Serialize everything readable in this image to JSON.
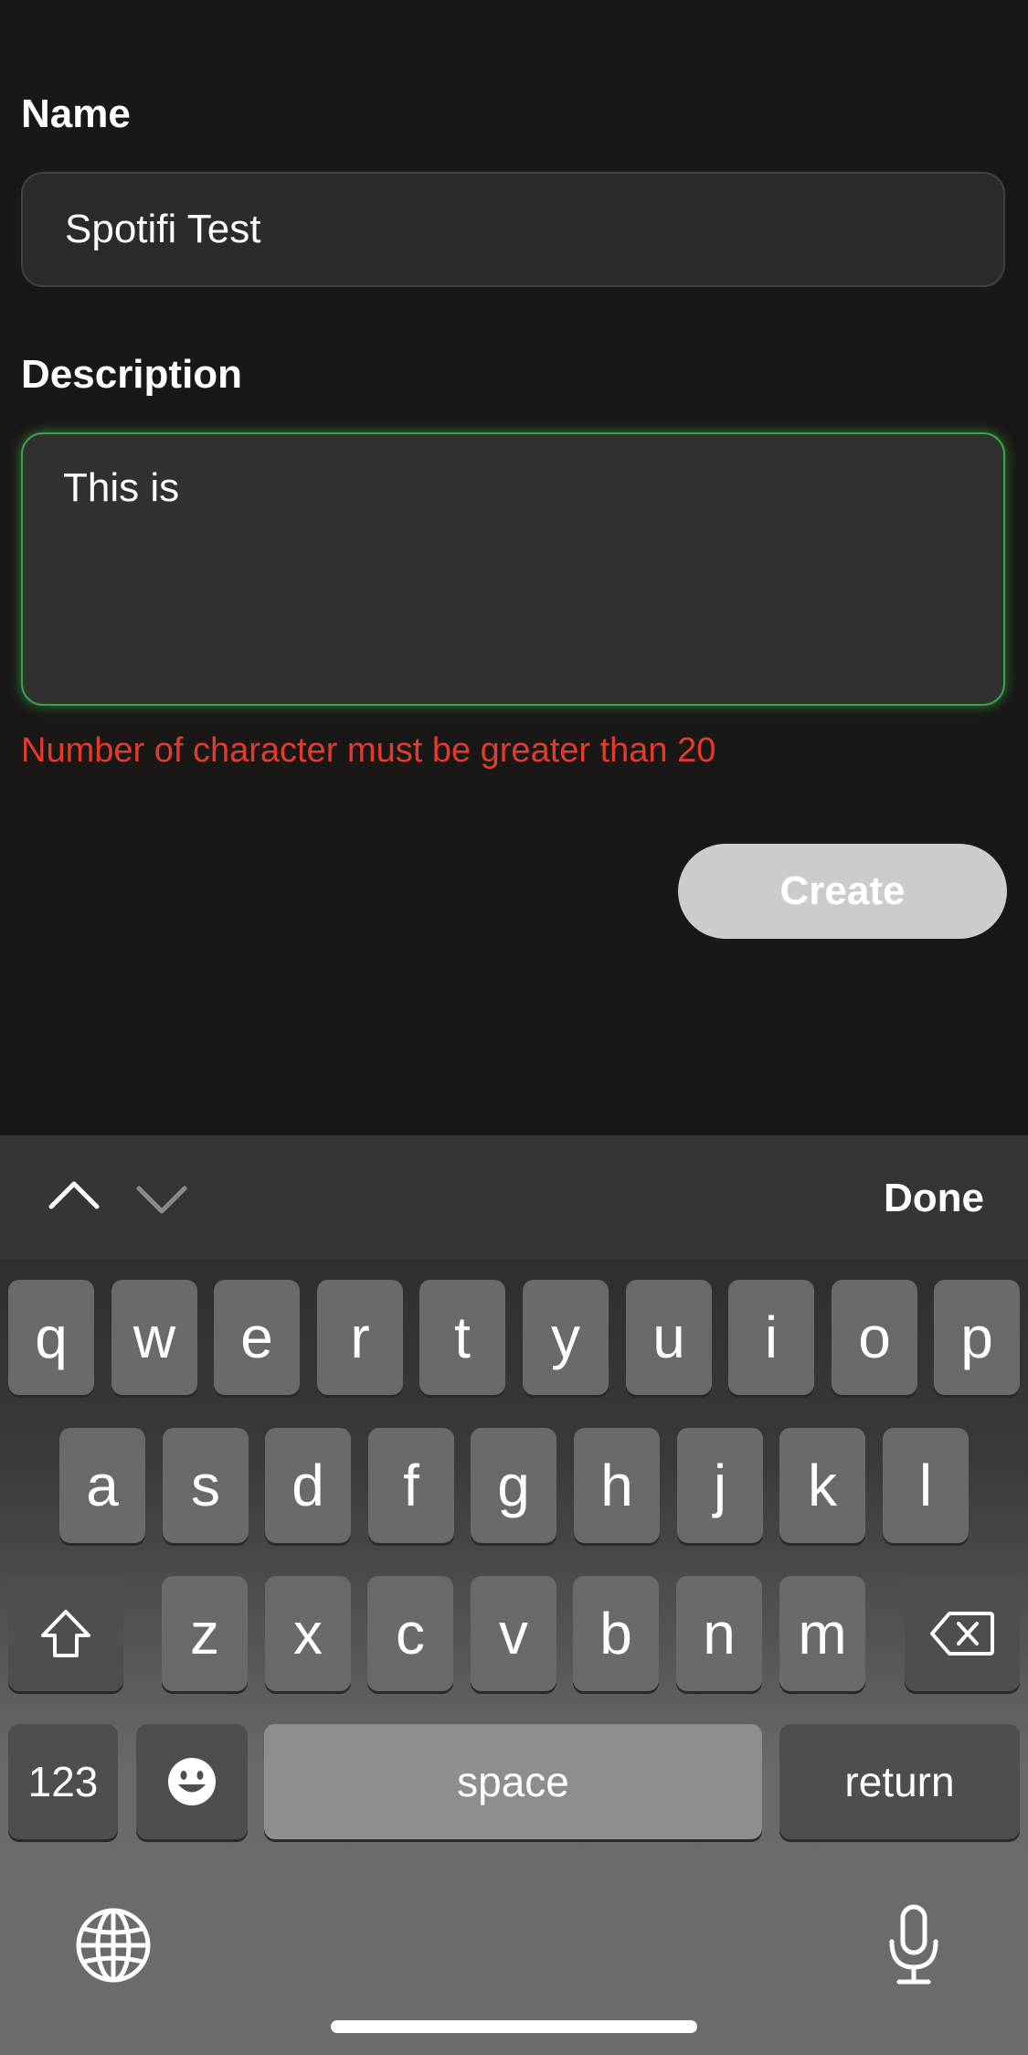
{
  "form": {
    "name_label": "Name",
    "name_value": "Spotifi Test",
    "description_label": "Description",
    "description_value": "This is",
    "error_message": "Number of character must be greater than 20",
    "create_label": "Create"
  },
  "keyboard": {
    "toolbar": {
      "prev_icon": "chevron-up-icon",
      "next_icon": "chevron-down-icon",
      "done_label": "Done"
    },
    "rows": [
      [
        "q",
        "w",
        "e",
        "r",
        "t",
        "y",
        "u",
        "i",
        "o",
        "p"
      ],
      [
        "a",
        "s",
        "d",
        "f",
        "g",
        "h",
        "j",
        "k",
        "l"
      ],
      [
        "z",
        "x",
        "c",
        "v",
        "b",
        "n",
        "m"
      ]
    ],
    "shift_icon": "shift-icon",
    "delete_icon": "backspace-icon",
    "numbers_label": "123",
    "emoji_icon": "emoji-icon",
    "space_label": "space",
    "return_label": "return",
    "globe_icon": "globe-icon",
    "mic_icon": "microphone-icon"
  },
  "colors": {
    "background": "#1a1717",
    "field_background": "#2b2b2b",
    "focus_border": "#3ea24a",
    "error": "#e23b2e",
    "create_button": "#cccccc"
  }
}
